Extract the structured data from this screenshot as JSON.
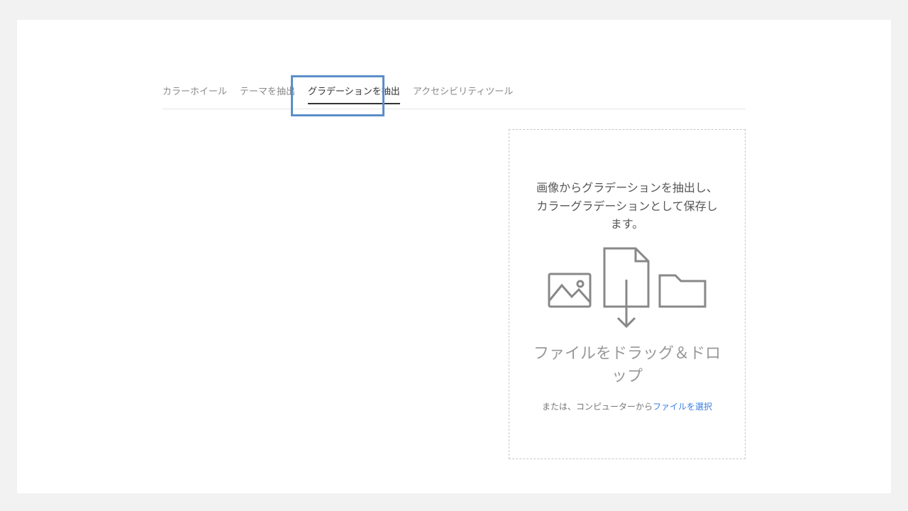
{
  "tabs": {
    "items": [
      {
        "label": "カラーホイール"
      },
      {
        "label": "テーマを抽出"
      },
      {
        "label": "グラデーションを抽出"
      },
      {
        "label": "アクセシビリティツール"
      }
    ],
    "activeIndex": 2
  },
  "dropzone": {
    "description": "画像からグラデーションを抽出し、カラーグラデーションとして保存します。",
    "dragLabel": "ファイルをドラッグ＆ドロップ",
    "altPrefix": "または、コンピューターから",
    "linkText": "ファイルを選択"
  }
}
